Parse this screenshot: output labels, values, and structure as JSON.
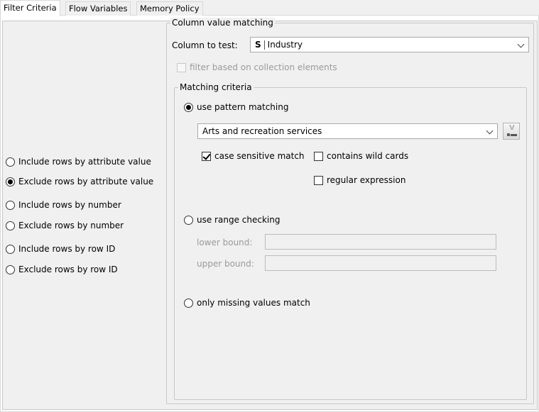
{
  "tabs": [
    {
      "label": "Filter Criteria",
      "active": true
    },
    {
      "label": "Flow Variables",
      "active": false
    },
    {
      "label": "Memory Policy",
      "active": false
    }
  ],
  "mode_options": [
    {
      "label": "Include rows by attribute value",
      "selected": false
    },
    {
      "label": "Exclude rows by attribute value",
      "selected": true
    },
    {
      "label": "Include rows by number",
      "selected": false
    },
    {
      "label": "Exclude rows by number",
      "selected": false
    },
    {
      "label": "Include rows by row ID",
      "selected": false
    },
    {
      "label": "Exclude rows by row ID",
      "selected": false
    }
  ],
  "column_value_matching": {
    "title": "Column value matching",
    "column_label": "Column to test:",
    "column_type_badge": "S",
    "column_value": "Industry",
    "collection_label": "filter based on collection elements",
    "collection_checked": false
  },
  "matching_criteria": {
    "title": "Matching criteria",
    "pattern_label": "use pattern matching",
    "pattern_selected": true,
    "pattern_value": "Arts and recreation services",
    "case_sensitive_label": "case sensitive match",
    "case_sensitive_checked": true,
    "wildcards_label": "contains wild cards",
    "wildcards_checked": false,
    "regex_label": "regular expression",
    "regex_checked": false,
    "range_label": "use range checking",
    "range_selected": false,
    "lower_bound_label": "lower bound:",
    "lower_bound_value": "",
    "upper_bound_label": "upper bound:",
    "upper_bound_value": "",
    "missing_label": "only missing values match",
    "missing_selected": false
  }
}
